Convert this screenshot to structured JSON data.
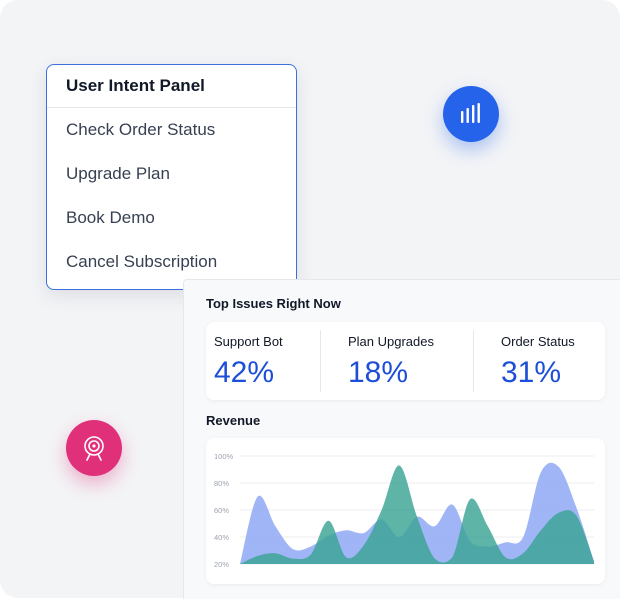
{
  "intent_panel": {
    "title": "User Intent Panel",
    "items": [
      "Check Order Status",
      "Upgrade Plan",
      "Book Demo",
      "Cancel Subscription"
    ]
  },
  "icons": {
    "chart_button": "bar-chart-icon",
    "target_button": "target-icon"
  },
  "dashboard": {
    "top_issues_title": "Top Issues Right Now",
    "stats": [
      {
        "label": "Support Bot",
        "value": "42%"
      },
      {
        "label": "Plan Upgrades",
        "value": "18%"
      },
      {
        "label": "Order Status",
        "value": "31%"
      }
    ],
    "revenue_title": "Revenue"
  },
  "chart_data": {
    "type": "area",
    "title": "Revenue",
    "yticks": [
      "100%",
      "80%",
      "60%",
      "40%",
      "20%"
    ],
    "ylim": [
      20,
      100
    ],
    "x": [
      0,
      5,
      10,
      15,
      20,
      25,
      30,
      35,
      40,
      45,
      50,
      55,
      60,
      65,
      70,
      75,
      80,
      85,
      90,
      95,
      100
    ],
    "series": [
      {
        "color": "#8fa8f5",
        "values": [
          20,
          70,
          48,
          31,
          33,
          41,
          45,
          43,
          53,
          40,
          55,
          48,
          64,
          37,
          33,
          36,
          40,
          88,
          92,
          62,
          22
        ]
      },
      {
        "color": "#3aa394",
        "values": [
          20,
          26,
          28,
          24,
          27,
          52,
          25,
          34,
          60,
          93,
          55,
          24,
          25,
          68,
          48,
          25,
          28,
          45,
          58,
          56,
          22
        ]
      }
    ],
    "colors": {
      "series_a": "#8fa8f5",
      "series_b": "#3aa394"
    }
  },
  "colors": {
    "accent_blue": "#2563eb",
    "accent_pink": "#e0307a",
    "value_blue": "#1d4ed8"
  }
}
